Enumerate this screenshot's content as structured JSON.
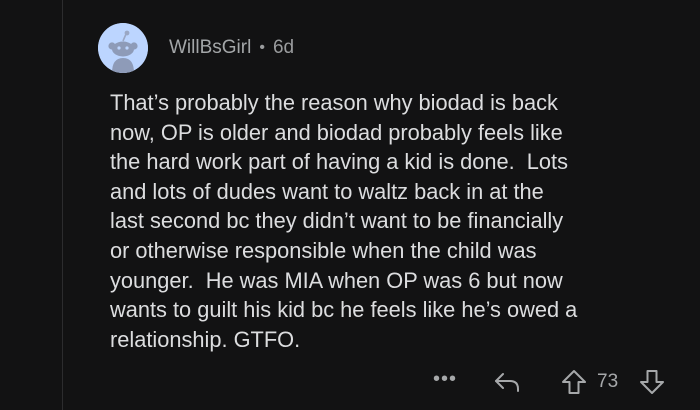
{
  "comment": {
    "username": "WillBsGirl",
    "separator": "•",
    "age": "6d",
    "avatar_icon": "reddit-snoo-avatar-icon",
    "body_lines": [
      "That’s probably the reason why biodad is back",
      "now, OP is older and biodad probably feels like",
      "the hard work part of having a kid is done.  Lots",
      "and lots of dudes want to waltz back in at the",
      "last second bc they didn’t want to be financially",
      "or otherwise responsible when the child was",
      "younger.  He was MIA when OP was 6 but now",
      "wants to guilt his kid bc he feels like he’s owed a",
      "relationship. GTFO."
    ]
  },
  "actions": {
    "more_label": "•••",
    "reply_icon": "reply-arrow-icon",
    "upvote_icon": "upvote-arrow-icon",
    "score": "73",
    "downvote_icon": "downvote-arrow-icon"
  },
  "colors": {
    "background": "#121213",
    "text": "#dcdddf",
    "muted": "#a6a8aa",
    "avatar_bg": "#bcd5ff"
  }
}
